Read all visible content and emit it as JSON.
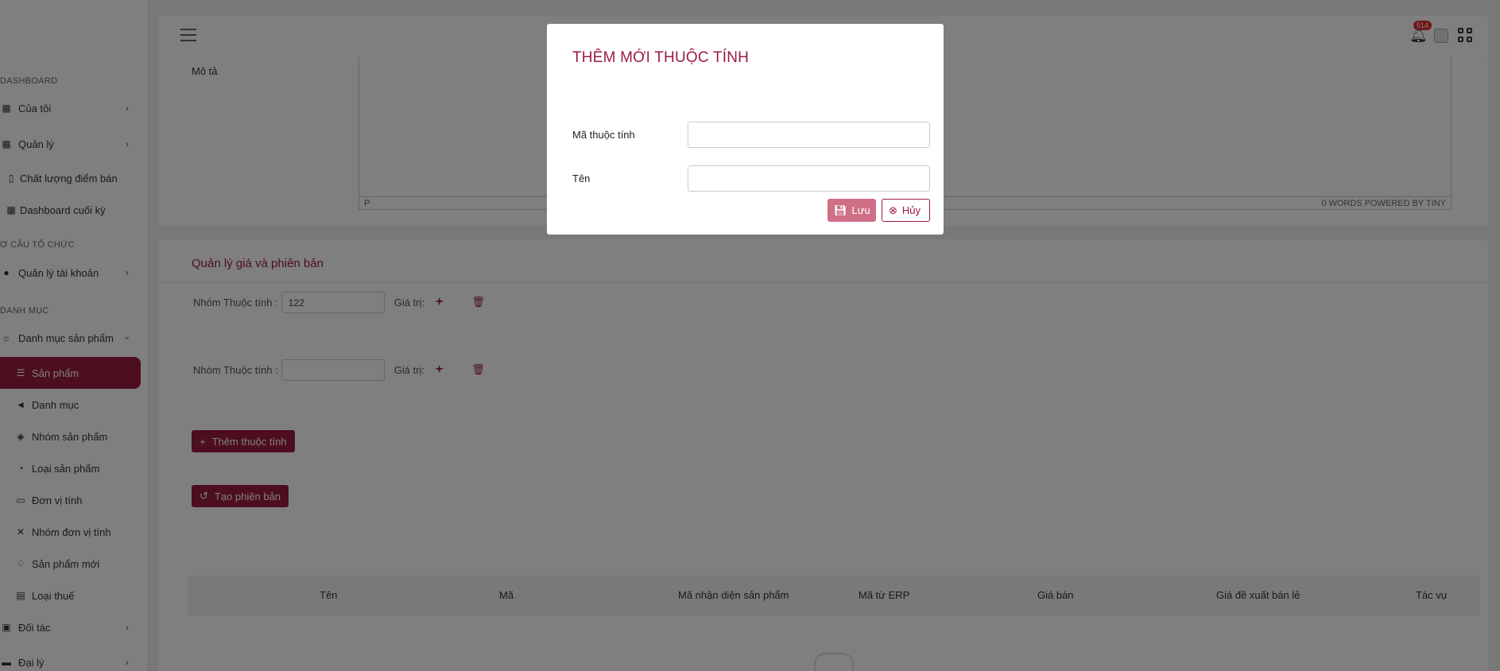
{
  "sidebar": {
    "sections": {
      "dashboard": "DASHBOARD",
      "org": "Ơ CẤU TỔ CHỨC",
      "catalog": "DANH MỤC"
    },
    "items": {
      "mine": "Của tôi",
      "manage": "Quản lý",
      "store_quality": "Chất lượng điểm bán",
      "period_dashboard": "Dashboard cuối kỳ",
      "accounts": "Quản lý tài khoản",
      "product_catalog": "Danh mục sản phẩm",
      "products": "Sản phẩm",
      "categories": "Danh mục",
      "product_groups": "Nhóm sản phẩm",
      "product_types": "Loại sản phẩm",
      "units": "Đơn vị tính",
      "unit_groups": "Nhóm đơn vị tính",
      "new_products": "Sản phẩm mới",
      "tax_types": "Loại thuế",
      "partners": "Đối tác",
      "agents": "Đại lý"
    }
  },
  "header": {
    "notification_count": "514"
  },
  "description": {
    "label": "Mô tả",
    "editor_path": "P",
    "editor_status": "0 WORDS  POWERED BY TINY"
  },
  "pricing": {
    "title": "Quản lý giá và phiên bản",
    "attr_group_label": "Nhóm Thuộc tính :",
    "value_label": "Giá trị:",
    "rows": [
      {
        "group_value": "122"
      },
      {
        "group_value": ""
      }
    ],
    "add_attr_button": "Thêm thuộc tính",
    "create_version_button": "Tạo phiên bản",
    "table_headers": [
      "Tên",
      "Mã",
      "Mã nhận diện sản phẩm",
      "Mã từ ERP",
      "Giá bán",
      "Giá đề xuất bán lẻ",
      "Tác vụ"
    ]
  },
  "modal": {
    "title": "THÊM MỚI THUỘC TÍNH",
    "code_label": "Mã thuộc tính",
    "code_value": "",
    "name_label": "Tên",
    "name_value": "",
    "save_button": "Lưu",
    "cancel_button": "Hủy"
  },
  "colors": {
    "brand": "#9b1c3e",
    "brand_light": "#cf6f86"
  }
}
